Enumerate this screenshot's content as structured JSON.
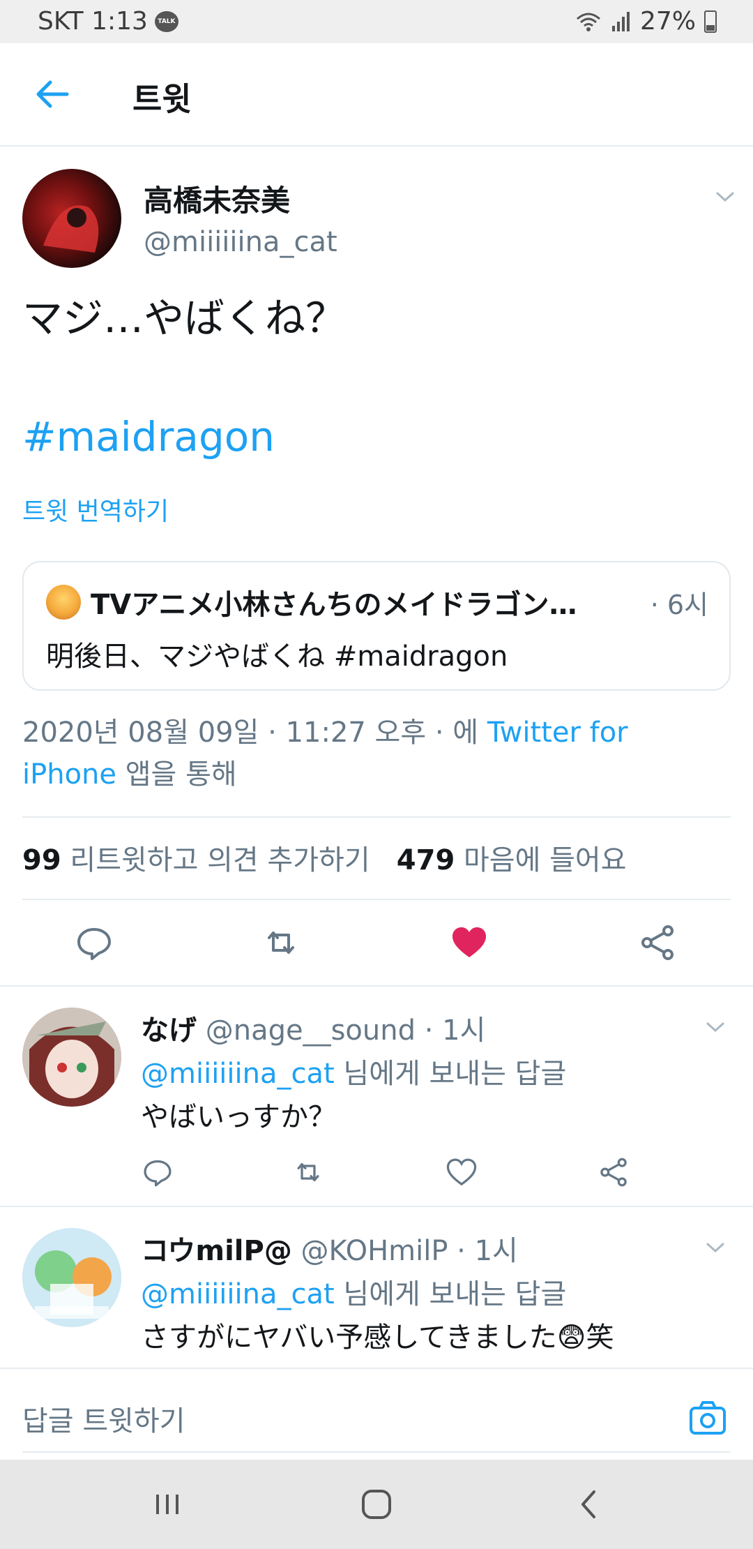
{
  "status_bar": {
    "carrier_time": "SKT 1:13",
    "talk_badge": "TALK",
    "battery": "27%"
  },
  "header": {
    "title": "트윗"
  },
  "tweet": {
    "name": "高橋未奈美",
    "handle": "@miiiiiina_cat",
    "text": "マジ…やばくね？",
    "hashtag": "#maidragon",
    "translate": "트윗 번역하기",
    "quote": {
      "name": "TVアニメ小林さんちのメイドラゴン…",
      "time": "· 6시",
      "text": "明後日、マジやばくね #maidragon"
    },
    "meta_date": "2020년 08월 09일 · 11:27 오후 · 에",
    "meta_via_link": "Twitter for iPhone",
    "meta_via_suffix": "앱을 통해",
    "retweets_count": "99",
    "retweets_label": "리트윗하고 의견 추가하기",
    "likes_count": "479",
    "likes_label": "마음에 들어요",
    "accent": "#1da1f2",
    "like_color": "#e0245e"
  },
  "replies": [
    {
      "name": "なげ",
      "handle_time": "@nage__sound · 1시",
      "reply_to_link": "@miiiiiina_cat",
      "reply_to_suffix": "님에게 보내는 답글",
      "text": "やばいっすか？"
    },
    {
      "name": "コウmilP@",
      "handle_time": "@KOHmilP · 1시",
      "reply_to_link": "@miiiiiina_cat",
      "reply_to_suffix": "님에게 보내는 답글",
      "text": "さすがにヤバい予感してきました😨笑"
    }
  ],
  "composer": {
    "placeholder": "답글 트윗하기"
  },
  "icons": {
    "back": "arrow-left-icon",
    "caret": "chevron-down-icon",
    "reply": "reply-icon",
    "retweet": "retweet-icon",
    "like": "heart-icon",
    "share": "share-icon",
    "camera": "camera-icon"
  }
}
